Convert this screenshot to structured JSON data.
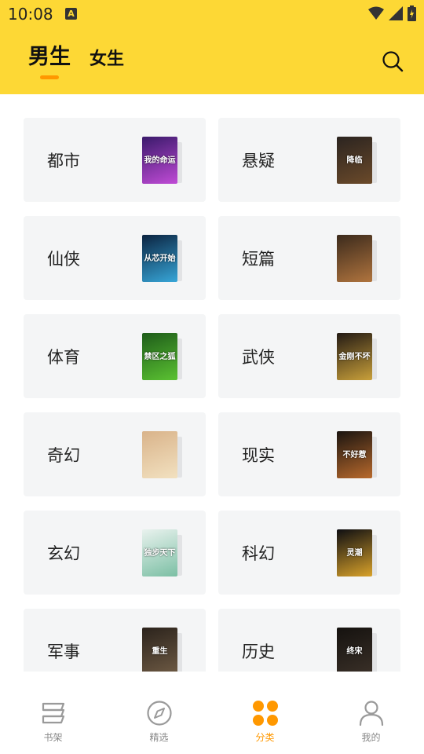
{
  "status_bar": {
    "time": "10:08",
    "app_icon_letter": "A"
  },
  "header": {
    "tabs": [
      {
        "label": "男生",
        "active": true
      },
      {
        "label": "女生",
        "active": false
      }
    ],
    "search_icon": "search-icon",
    "accent_color": "#fdd835",
    "indicator_color": "#ff9800"
  },
  "categories": [
    {
      "label": "都市",
      "cover_title": "我的命运",
      "cover_colors": [
        "#3a1a6b",
        "#c04bd6"
      ]
    },
    {
      "label": "悬疑",
      "cover_title": "降临",
      "cover_colors": [
        "#2b2420",
        "#6b4a2a"
      ]
    },
    {
      "label": "仙侠",
      "cover_title": "从芯开始",
      "cover_colors": [
        "#0b2340",
        "#37a6d8"
      ]
    },
    {
      "label": "短篇",
      "cover_title": "",
      "cover_colors": [
        "#3b2a1c",
        "#b0743e"
      ]
    },
    {
      "label": "体育",
      "cover_title": "禁区之狐",
      "cover_colors": [
        "#1e5c1a",
        "#5bc232"
      ]
    },
    {
      "label": "武侠",
      "cover_title": "金刚不坏",
      "cover_colors": [
        "#231a14",
        "#c9a03a"
      ]
    },
    {
      "label": "奇幻",
      "cover_title": "",
      "cover_colors": [
        "#d9b38a",
        "#f2e1c0"
      ]
    },
    {
      "label": "现实",
      "cover_title": "不好惹",
      "cover_colors": [
        "#1a1410",
        "#b8692c"
      ]
    },
    {
      "label": "玄幻",
      "cover_title": "独步天下",
      "cover_colors": [
        "#e9f2ee",
        "#7bbfa4"
      ]
    },
    {
      "label": "科幻",
      "cover_title": "灵潮",
      "cover_colors": [
        "#0e0e12",
        "#d9a22a"
      ]
    },
    {
      "label": "军事",
      "cover_title": "重生",
      "cover_colors": [
        "#2b231c",
        "#6e5a44"
      ]
    },
    {
      "label": "历史",
      "cover_title": "终宋",
      "cover_colors": [
        "#15120f",
        "#3a3028"
      ]
    }
  ],
  "bottom_nav": [
    {
      "label": "书架",
      "icon": "bookshelf-icon",
      "active": false
    },
    {
      "label": "精选",
      "icon": "compass-icon",
      "active": false
    },
    {
      "label": "分类",
      "icon": "category-grid-icon",
      "active": true
    },
    {
      "label": "我的",
      "icon": "profile-icon",
      "active": false
    }
  ]
}
